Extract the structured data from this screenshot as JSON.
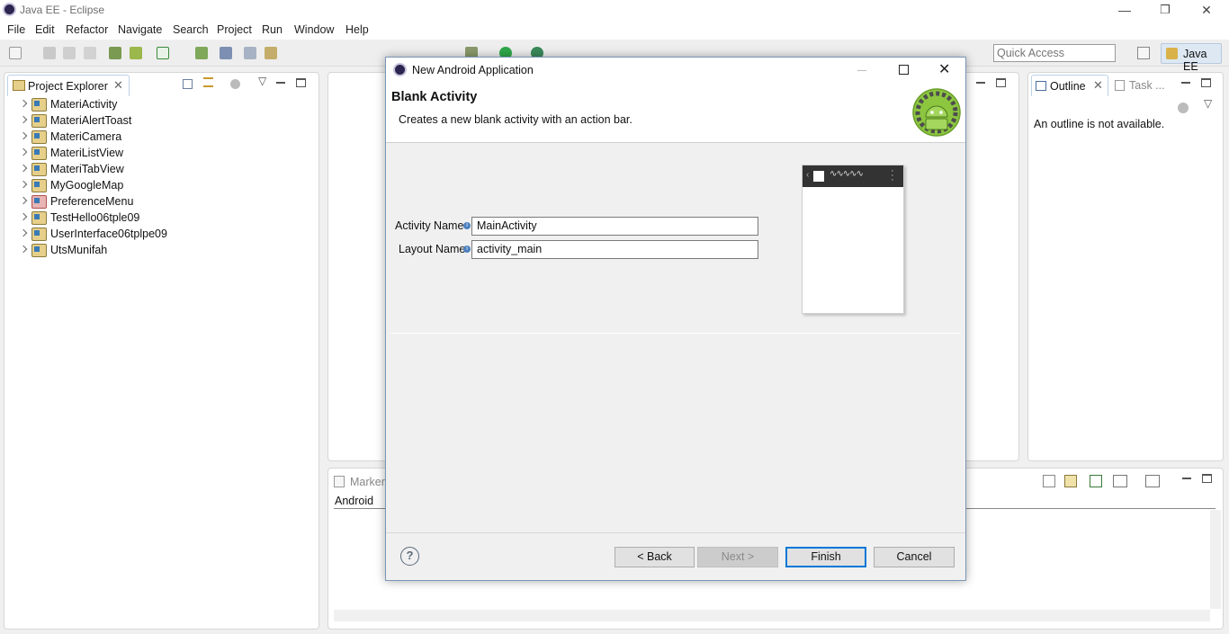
{
  "window": {
    "title": "Java EE - Eclipse",
    "minimize": "—",
    "restore": "❐",
    "close": "✕"
  },
  "menu": [
    "File",
    "Edit",
    "Refactor",
    "Navigate",
    "Search",
    "Project",
    "Run",
    "Window",
    "Help"
  ],
  "toolbar": {
    "quick_access_placeholder": "Quick Access",
    "perspective": "Java EE"
  },
  "project_explorer": {
    "tab": "Project Explorer",
    "projects": [
      "MateriActivity",
      "MateriAlertToast",
      "MateriCamera",
      "MateriListView",
      "MateriTabView",
      "MyGoogleMap",
      "PreferenceMenu",
      "TestHello06tple09",
      "UserInterface06tplpe09",
      "UtsMunifah"
    ]
  },
  "outline": {
    "tab": "Outline",
    "tab2": "Task ...",
    "message": "An outline is not available."
  },
  "markers": {
    "tab": "Markers",
    "subtab": "Android"
  },
  "dialog": {
    "title": "New Android Application",
    "heading": "Blank Activity",
    "description": "Creates a new blank activity with an action bar.",
    "activity_name_label": "Activity Name",
    "activity_name_value": "MainActivity",
    "layout_name_label": "Layout Name",
    "layout_name_value": "activity_main",
    "buttons": {
      "help": "?",
      "back": "< Back",
      "next": "Next >",
      "finish": "Finish",
      "cancel": "Cancel"
    }
  },
  "colors": {
    "accent": "#0078d7",
    "android_green": "#8cc63f"
  }
}
